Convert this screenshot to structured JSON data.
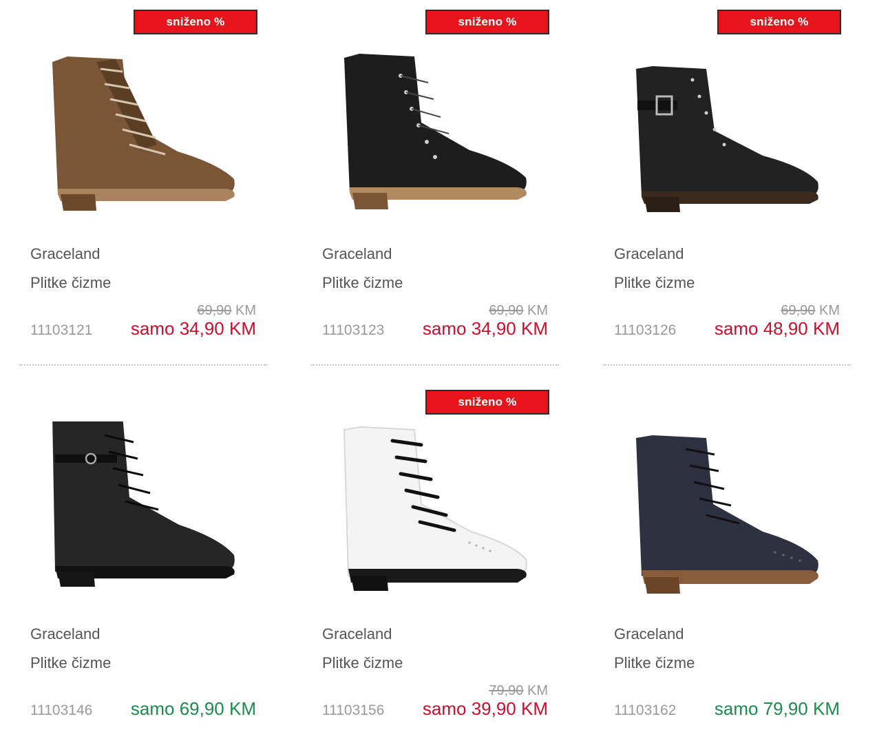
{
  "colors": {
    "sale_badge": "#e8141c",
    "sale_price": "#c8102e",
    "regular_price": "#1e8a4c",
    "muted": "#999999"
  },
  "products": [
    {
      "badge": "sniženo %",
      "image": "brown-lace-up-boot",
      "brand": "Graceland",
      "type": "Plitke čizme",
      "old_price": "69,90",
      "old_currency": "KM",
      "code": "11103121",
      "price": "samo 34,90 KM"
    },
    {
      "badge": "sniženo %",
      "image": "black-suede-lace-up-boot",
      "brand": "Graceland",
      "type": "Plitke čizme",
      "old_price": "69,90",
      "old_currency": "KM",
      "code": "11103123",
      "price": "samo 34,90 KM"
    },
    {
      "badge": "sniženo %",
      "image": "black-brogue-buckle-boot",
      "brand": "Graceland",
      "type": "Plitke čizme",
      "old_price": "69,90",
      "old_currency": "KM",
      "code": "11103126",
      "price": "samo 48,90 KM"
    },
    {
      "badge": "",
      "image": "black-leather-lace-up-boot",
      "brand": "Graceland",
      "type": "Plitke čizme",
      "old_price": "",
      "old_currency": "",
      "code": "11103146",
      "price": "samo 69,90 KM"
    },
    {
      "badge": "sniženo %",
      "image": "white-brogue-lace-up-boot",
      "brand": "Graceland",
      "type": "Plitke čizme",
      "old_price": "79,90",
      "old_currency": "KM",
      "code": "11103156",
      "price": "samo 39,90 KM"
    },
    {
      "badge": "",
      "image": "navy-brogue-lace-up-boot",
      "brand": "Graceland",
      "type": "Plitke čizme",
      "old_price": "",
      "old_currency": "",
      "code": "11103162",
      "price": "samo 79,90 KM"
    }
  ]
}
